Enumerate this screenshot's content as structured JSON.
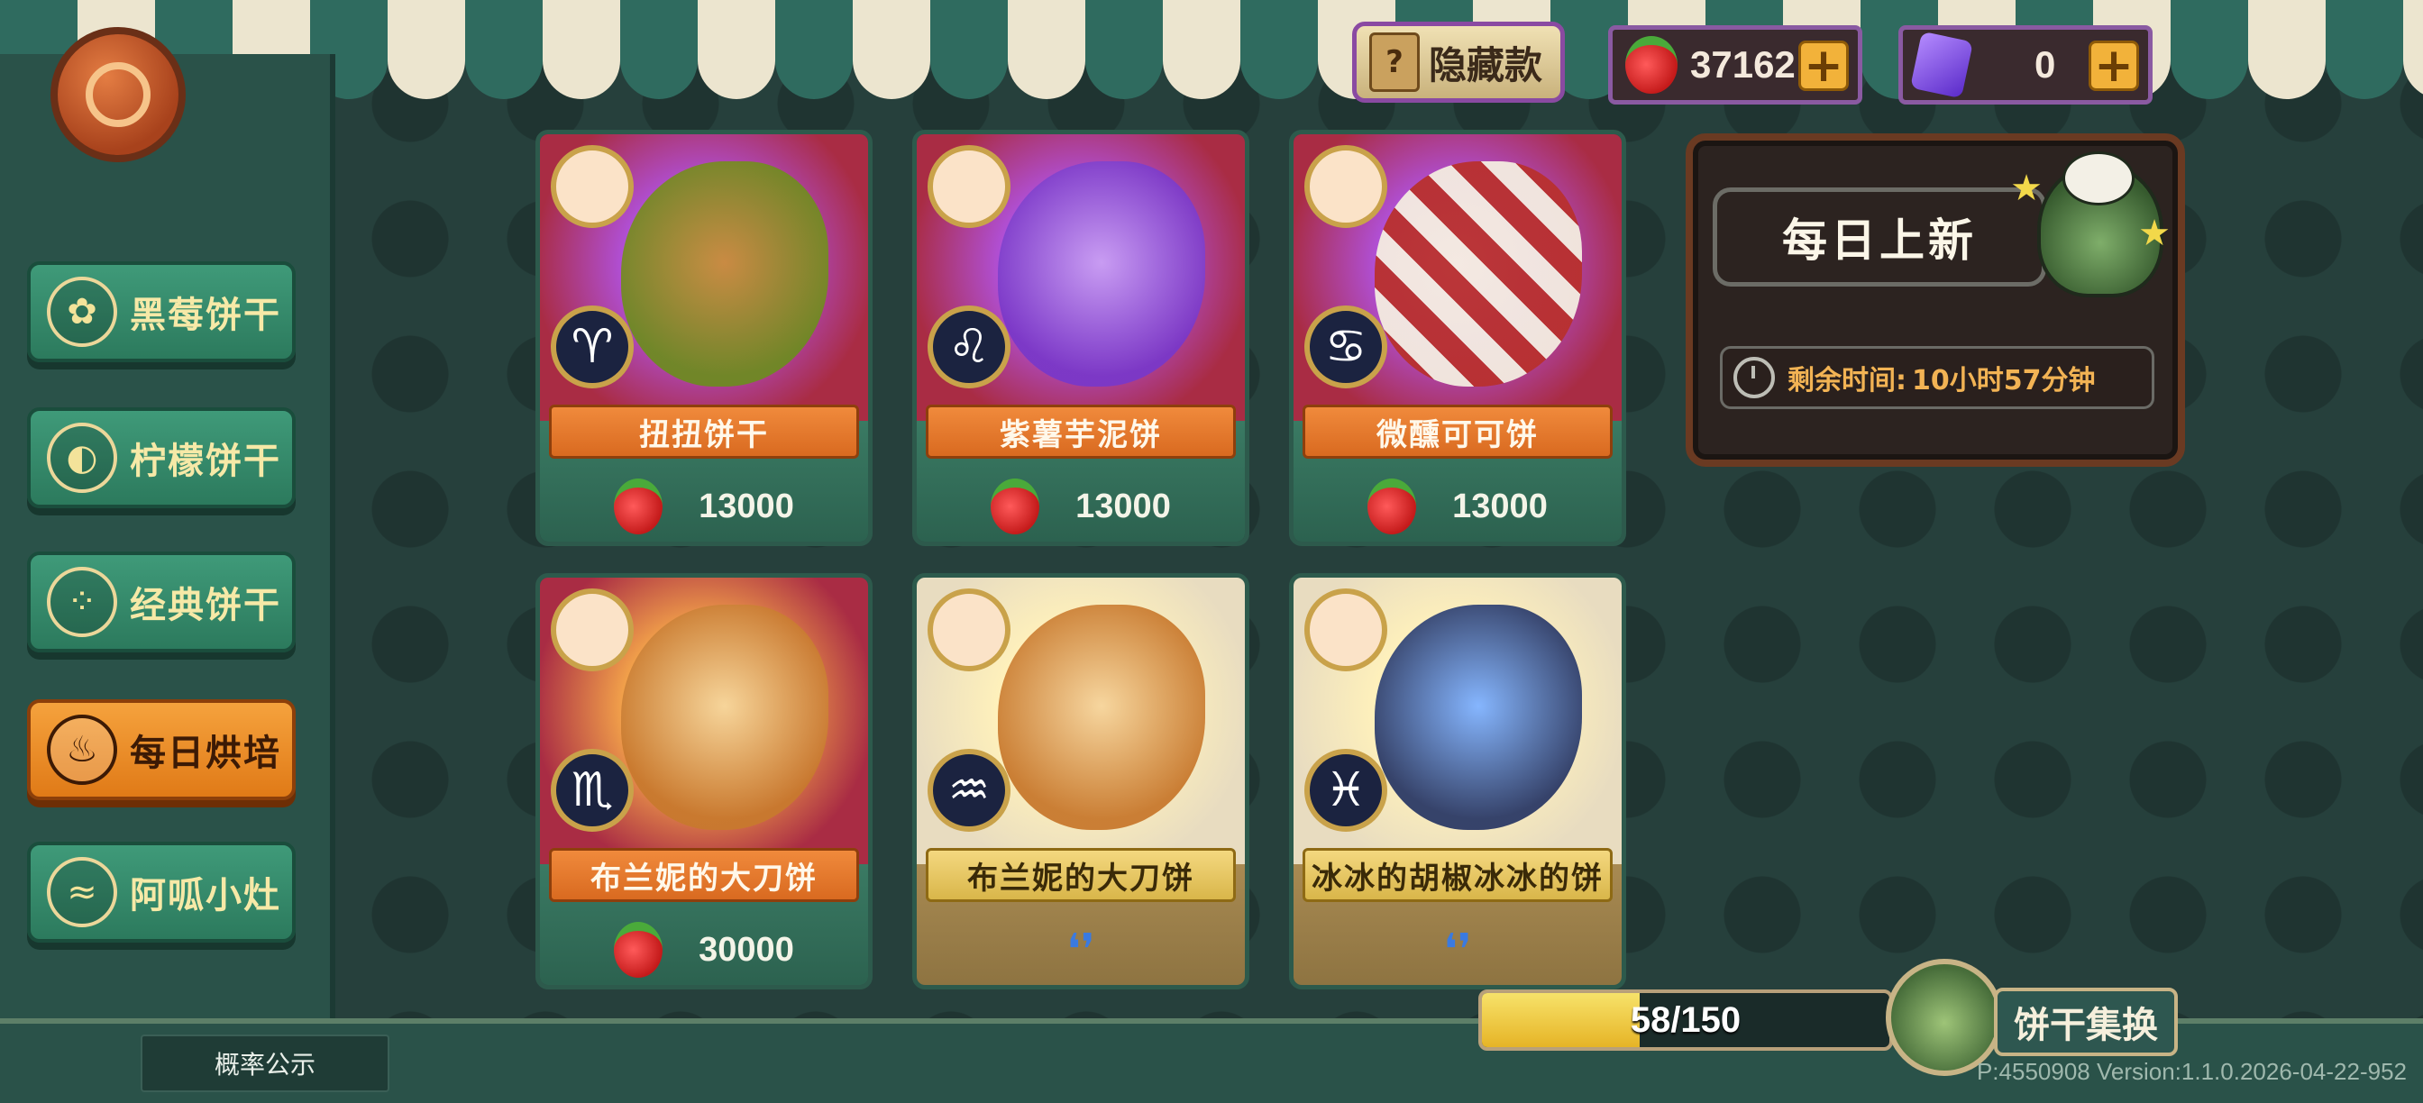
{
  "top_bar": {
    "hidden_label": "隐藏款",
    "strawberry_count": "37162",
    "gem_count": "0",
    "plus_label": "+"
  },
  "sidebar": {
    "items": [
      {
        "label": "黑莓饼干",
        "icon": "blackberry-icon"
      },
      {
        "label": "柠檬饼干",
        "icon": "lemon-icon"
      },
      {
        "label": "经典饼干",
        "icon": "cookie-icon"
      },
      {
        "label": "每日烘培",
        "icon": "bread-icon",
        "active": true
      },
      {
        "label": "阿呱小灶",
        "icon": "stove-icon"
      }
    ]
  },
  "cards": [
    {
      "name": "扭扭饼干",
      "price": "13000",
      "zodiac": "♈",
      "style": "red"
    },
    {
      "name": "紫薯芋泥饼",
      "price": "13000",
      "zodiac": "♌",
      "style": "red"
    },
    {
      "name": "微醺可可饼",
      "price": "13000",
      "zodiac": "♋",
      "style": "red"
    },
    {
      "name": "布兰妮的大刀饼",
      "price": "30000",
      "zodiac": "♏",
      "style": "red"
    },
    {
      "name": "布兰妮的大刀饼",
      "price": "",
      "zodiac": "♒",
      "style": "cream"
    },
    {
      "name": "冰冰的胡椒冰冰的饼",
      "price": "",
      "zodiac": "♓",
      "style": "cream"
    }
  ],
  "daily": {
    "title": "每日上新",
    "timer_label": "剩余时间:",
    "timer_value": "10小时57分钟"
  },
  "progress": {
    "text": "58/150",
    "current": 58,
    "max": 150
  },
  "exchange": {
    "label": "饼干集换"
  },
  "footer": {
    "probability_label": "概率公示",
    "version": "P:4550908 Version:1.1.0.2026-04-22-952"
  },
  "colors": {
    "accent_orange": "#e07a17",
    "panel_green": "#2a5249",
    "currency_border": "#8a5aa2"
  }
}
